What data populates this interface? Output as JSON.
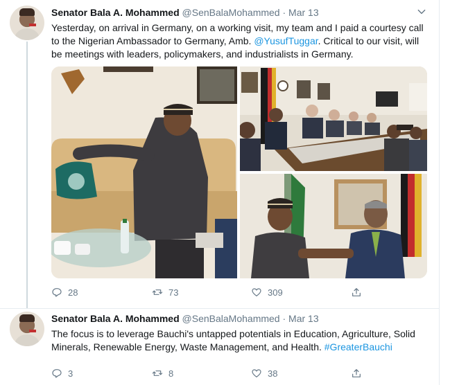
{
  "tweets": [
    {
      "name": "Senator Bala A. Mohammed",
      "handle": "@SenBalaMohammed",
      "dot": "·",
      "date": "Mar 13",
      "text_1": "Yesterday, on arrival in Germany, on a working visit, my team and I paid a courtesy call to the Nigerian Ambassador to Germany, Amb. ",
      "mention": "@YusufTuggar",
      "text_2": ". Critical to our visit, will be meetings with leaders, policymakers, and industrialists in Germany.",
      "replies": "28",
      "retweets": "73",
      "likes": "309"
    },
    {
      "name": "Senator Bala A. Mohammed",
      "handle": "@SenBalaMohammed",
      "dot": "·",
      "date": "Mar 13",
      "text_1": "The focus is to leverage Bauchi's untapped potentials in Education, Agriculture, Solid Minerals, Renewable Energy, Waste Management, and Health. ",
      "hashtag": "#GreaterBauchi",
      "replies": "3",
      "retweets": "8",
      "likes": "38"
    }
  ],
  "colors": {
    "text": "#14171a",
    "muted": "#657786",
    "link": "#1b95e0",
    "border": "#e6ecf0"
  },
  "icons": [
    "chevron-down-icon",
    "reply-icon",
    "retweet-icon",
    "like-icon",
    "share-icon"
  ]
}
